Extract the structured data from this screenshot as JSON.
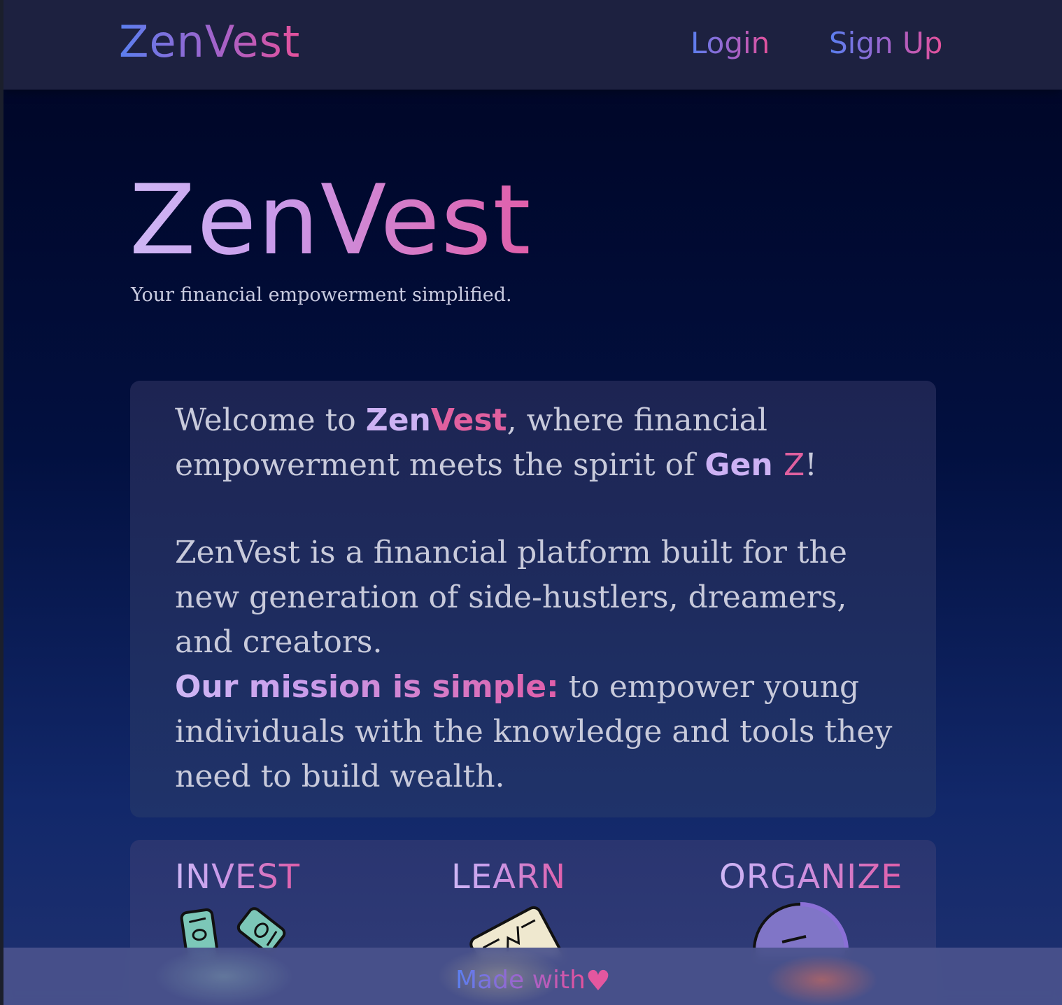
{
  "header": {
    "brand": "ZenVest",
    "nav": {
      "login": "Login",
      "signup": "Sign Up"
    }
  },
  "hero": {
    "title": "ZenVest",
    "subtitle": "Your financial empowerment simplified."
  },
  "intro": {
    "p1_prefix": "Welcome to ",
    "p1_brand_a": "Zen",
    "p1_brand_b": "Vest",
    "p1_mid": ", where financial empowerment meets the spirit of ",
    "p1_gen_a": "Gen ",
    "p1_gen_b": "Z",
    "p1_suffix": "!",
    "p2": "ZenVest is a financial platform built for the new generation of side-hustlers, dreamers, and creators.",
    "p3_highlight": "Our mission is simple:",
    "p3_rest": " to empower young individuals with the knowledge and tools they need to build wealth."
  },
  "features": [
    {
      "title": "INVEST",
      "icon": "money-bills-icon"
    },
    {
      "title": "LEARN",
      "icon": "newspaper-chart-icon"
    },
    {
      "title": "ORGANIZE",
      "icon": "pie-chart-icon"
    }
  ],
  "footer": {
    "text": "Made with",
    "heart": "♥"
  },
  "colors": {
    "gradient_start": "#5a7ff0",
    "gradient_mid": "#a462c9",
    "gradient_end": "#e6519b",
    "light_gradient_start": "#cfb7f5",
    "text_body": "#c8cadb",
    "topbar_bg": "#1d2140",
    "card_bg": "#1f2a5e"
  }
}
